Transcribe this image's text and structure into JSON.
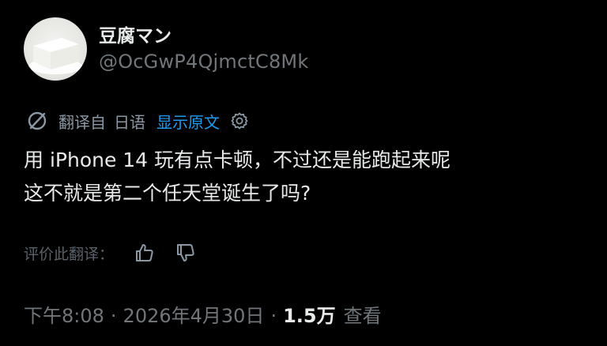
{
  "profile": {
    "display_name": "豆腐マン",
    "handle": "@OcGwP4QjmctC8Mk"
  },
  "translation": {
    "label": "翻译自",
    "language": "日语",
    "show_original": "显示原文",
    "icons": [
      "translate-icon",
      "settings-icon"
    ]
  },
  "tweet": {
    "lines": [
      "用 iPhone 14 玩有点卡顿，不过还是能跑起来呢",
      "这不就是第二个任天堂诞生了吗?"
    ]
  },
  "rating": {
    "label": "评价此翻译：",
    "icons": [
      "thumbs-up-icon",
      "thumbs-down-icon"
    ]
  },
  "meta": {
    "time": "下午8:08",
    "separator": "·",
    "date": "2026年4月30日",
    "views_count": "1.5万",
    "views_label": "查看"
  },
  "colors": {
    "background": "#000000",
    "text": "#e7e9ea",
    "secondary": "#71767b",
    "link": "#1d9bf0"
  }
}
